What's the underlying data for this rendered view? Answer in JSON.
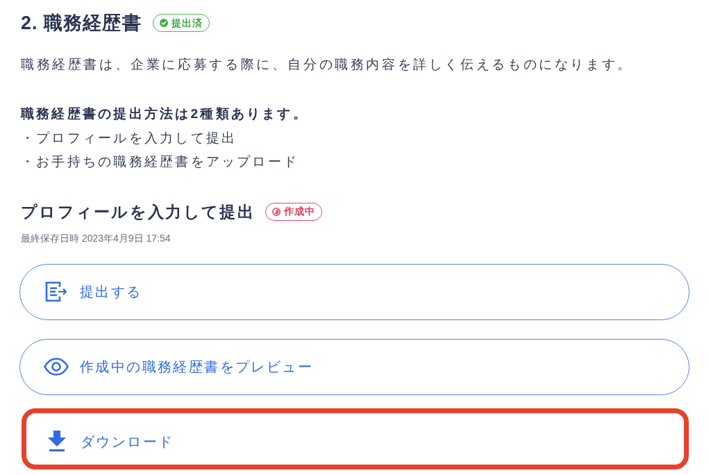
{
  "section": {
    "title": "2. 職務経歴書",
    "status_badge": {
      "label": "提出済",
      "kind": "submitted"
    },
    "description": "職務経歴書は、企業に応募する際に、自分の職務内容を詳しく伝えるものになります。",
    "methods_heading": "職務経歴書の提出方法は2種類あります。",
    "methods": [
      "・プロフィールを入力して提出",
      "・お手持ちの職務経歴書をアップロード"
    ]
  },
  "profile": {
    "heading": "プロフィールを入力して提出",
    "status_badge": {
      "label": "作成中",
      "kind": "in_progress"
    },
    "last_saved": "最終保存日時 2023年4月9日 17:54"
  },
  "actions": [
    {
      "label": "提出する",
      "kind": "submit",
      "highlighted": false
    },
    {
      "label": "作成中の職務経歴書をプレビュー",
      "kind": "preview",
      "highlighted": false
    },
    {
      "label": "ダウンロード",
      "kind": "download",
      "highlighted": true
    }
  ]
}
